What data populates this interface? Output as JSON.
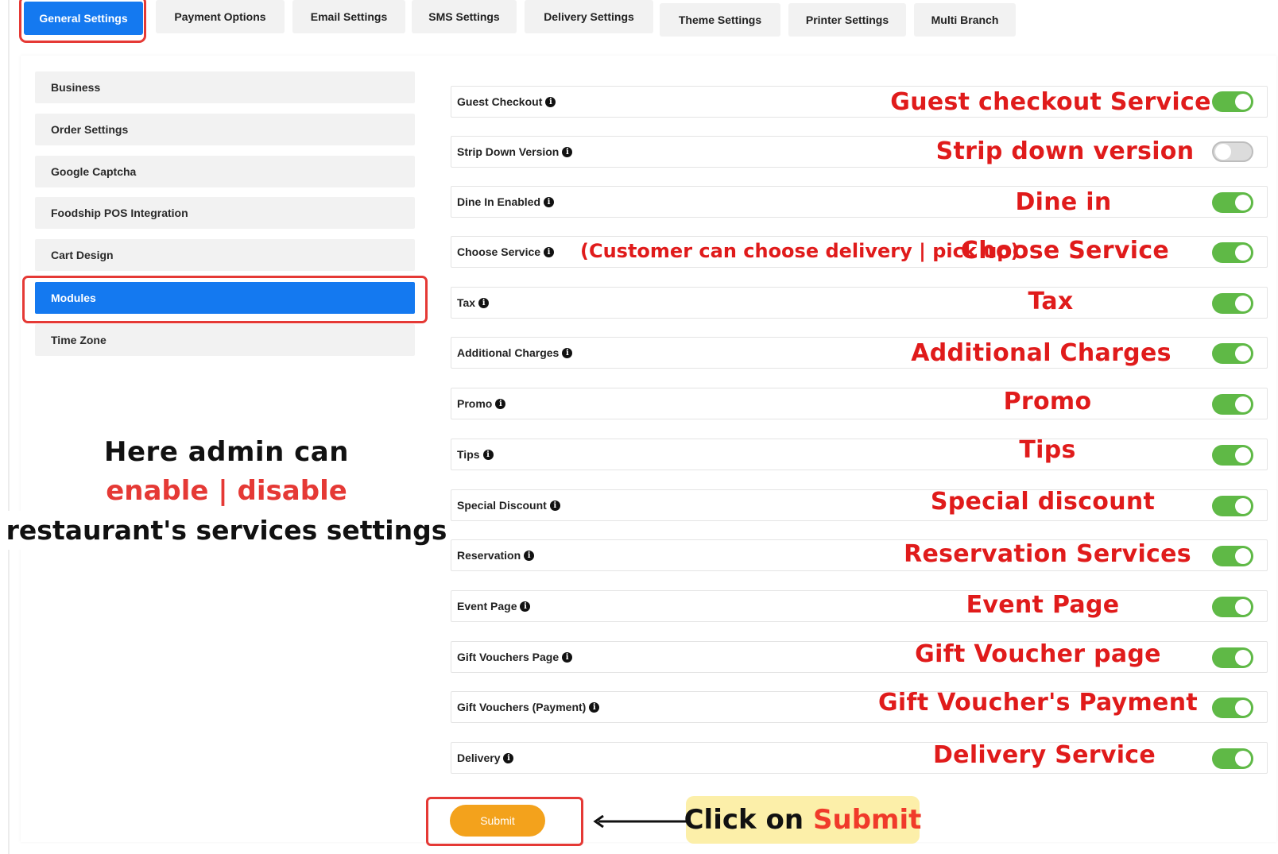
{
  "tabs": [
    {
      "label": "General Settings",
      "active": true
    },
    {
      "label": "Payment Options"
    },
    {
      "label": "Email Settings"
    },
    {
      "label": "SMS Settings"
    },
    {
      "label": "Delivery Settings"
    },
    {
      "label": "Theme Settings"
    },
    {
      "label": "Printer Settings"
    },
    {
      "label": "Multi Branch"
    }
  ],
  "sidebar": {
    "items": [
      {
        "label": "Business"
      },
      {
        "label": "Order Settings"
      },
      {
        "label": "Google Captcha"
      },
      {
        "label": "Foodship POS Integration"
      },
      {
        "label": "Cart Design"
      },
      {
        "label": "Modules",
        "active": true
      },
      {
        "label": "Time Zone"
      }
    ]
  },
  "caption": {
    "line1": "Here admin can",
    "line2": "enable | disable",
    "line3": "restaurant's services settings"
  },
  "settings": [
    {
      "label": "Guest Checkout",
      "annotation": "Guest checkout Service",
      "enabled": true
    },
    {
      "label": "Strip Down Version",
      "annotation": "Strip down version",
      "enabled": false
    },
    {
      "label": "Dine In Enabled",
      "annotation": "Dine in",
      "enabled": true
    },
    {
      "label": "Choose Service",
      "annotation": "Choose Service",
      "side_note": "(Customer can choose delivery | pick up)",
      "enabled": true
    },
    {
      "label": "Tax",
      "annotation": "Tax",
      "enabled": true
    },
    {
      "label": "Additional Charges",
      "annotation": "Additional Charges",
      "enabled": true
    },
    {
      "label": "Promo",
      "annotation": "Promo",
      "enabled": true
    },
    {
      "label": "Tips",
      "annotation": "Tips",
      "enabled": true
    },
    {
      "label": "Special Discount",
      "annotation": "Special discount",
      "enabled": true
    },
    {
      "label": "Reservation",
      "annotation": "Reservation Services",
      "enabled": true
    },
    {
      "label": "Event Page",
      "annotation": "Event Page",
      "enabled": true
    },
    {
      "label": "Gift Vouchers Page",
      "annotation": "Gift Voucher page",
      "enabled": true
    },
    {
      "label": "Gift Vouchers (Payment)",
      "annotation": "Gift Voucher's Payment",
      "enabled": true
    },
    {
      "label": "Delivery",
      "annotation": "Delivery  Service",
      "enabled": true
    }
  ],
  "submit": {
    "label": "Submit",
    "note_prefix": "Click on",
    "note_highlight": "Submit"
  },
  "colors": {
    "primary": "#1479f0",
    "toggle_on": "#5fb946",
    "annotation_red": "#e01b1b",
    "submit": "#f3a21c",
    "note_bg": "#fcefa9"
  }
}
